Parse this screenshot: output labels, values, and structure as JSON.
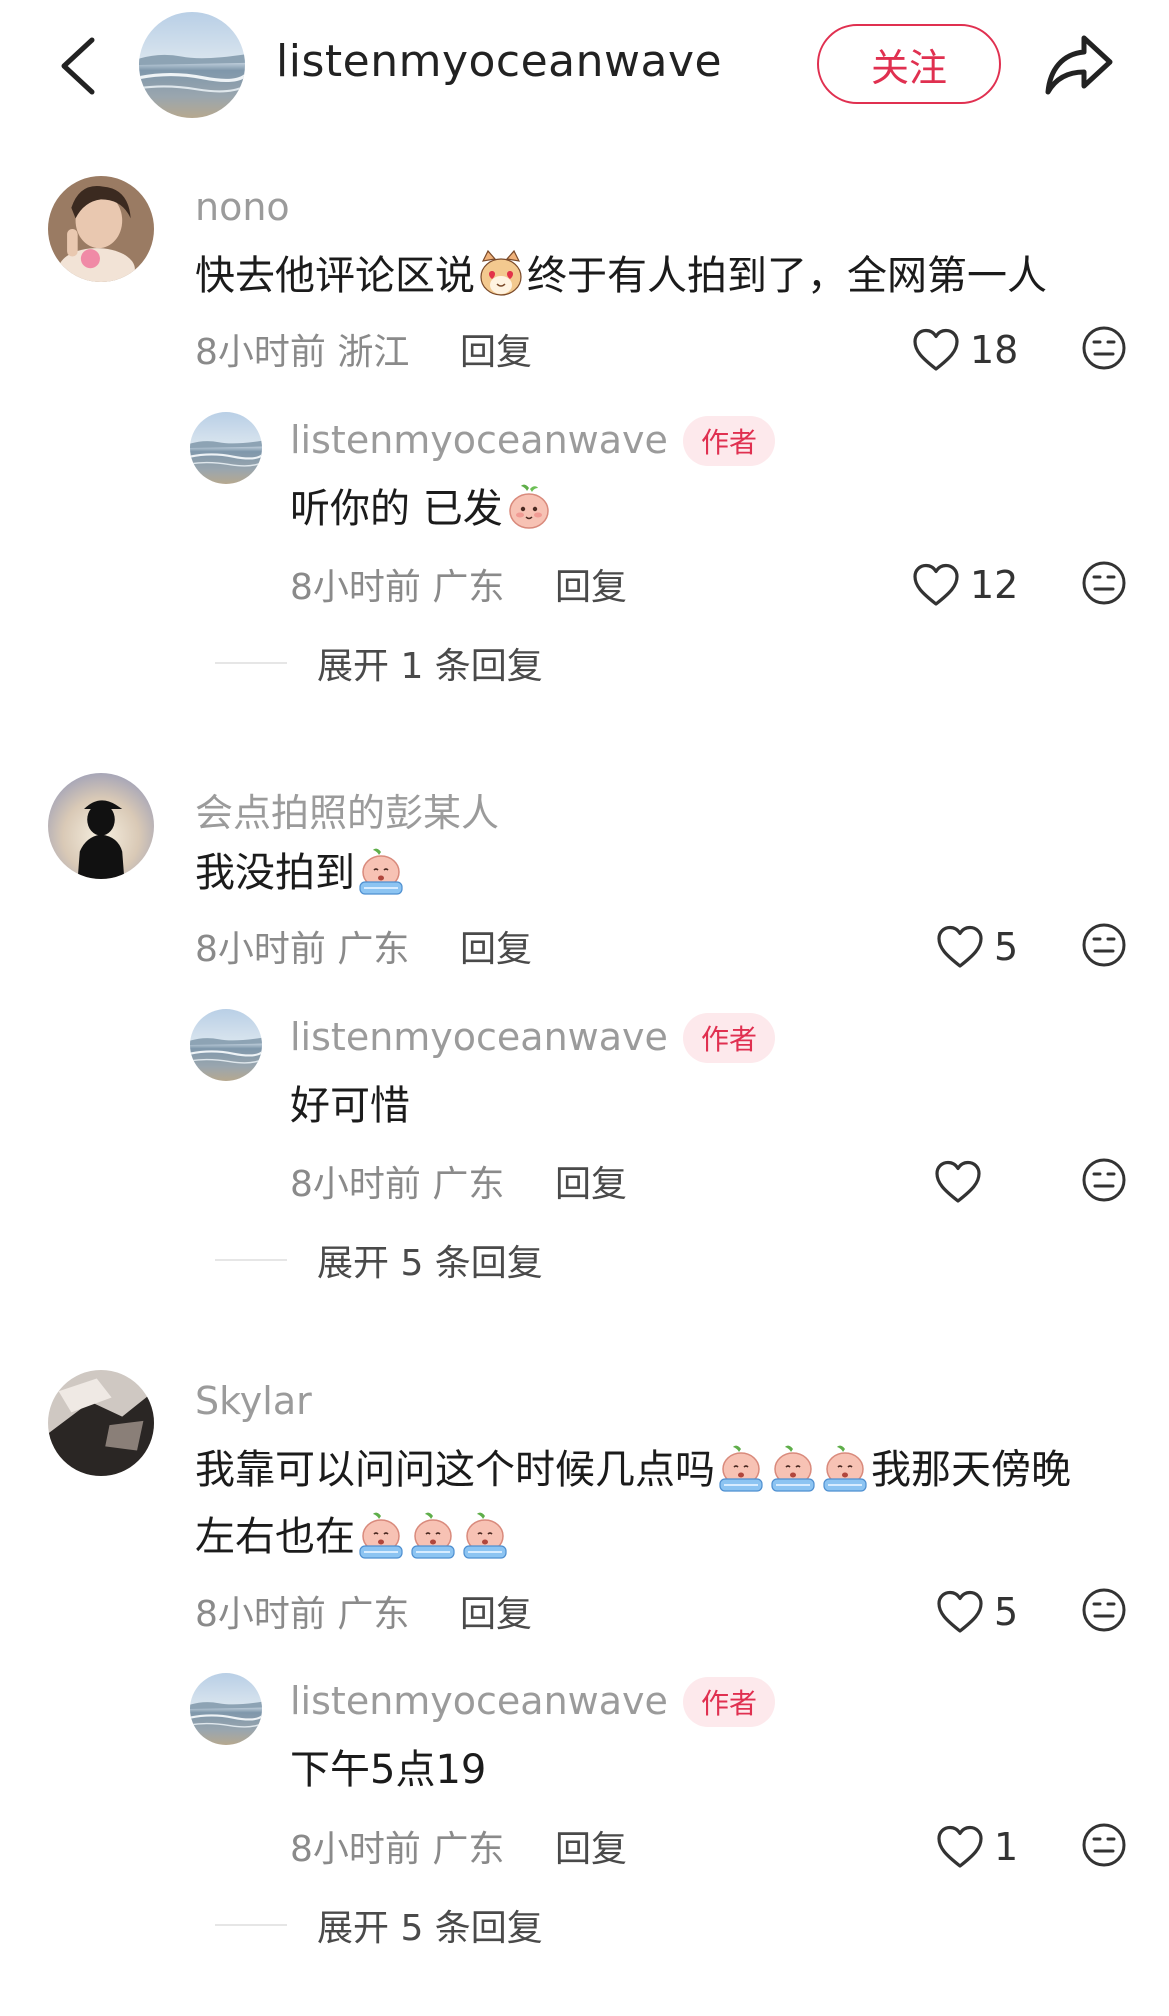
{
  "header": {
    "username": "listenmyoceanwave",
    "follow_label": "关注"
  },
  "colors": {
    "accent": "#e03050",
    "author_tag_bg": "#fde9ec",
    "meta": "#8a8a8a"
  },
  "comments": [
    {
      "username": "nono",
      "text_before": "快去他评论区说",
      "emoji": "heart-eyes-cat-emoji",
      "text_after": "终于有人拍到了，全网第一人",
      "time": "8小时前",
      "location": "浙江",
      "reply_label": "回复",
      "likes": "18",
      "reply": {
        "username": "listenmyoceanwave",
        "author_tag": "作者",
        "text": "听你的 已发",
        "emoji": "peach-shy-emoji",
        "time": "8小时前",
        "location": "广东",
        "reply_label": "回复",
        "likes": "12"
      },
      "expand_label": "展开 1 条回复"
    },
    {
      "username": "会点拍照的彭某人",
      "text": "我没拍到",
      "emoji": "peach-crying-emoji",
      "time": "8小时前",
      "location": "广东",
      "reply_label": "回复",
      "likes": "5",
      "reply": {
        "username": "listenmyoceanwave",
        "author_tag": "作者",
        "text": "好可惜",
        "time": "8小时前",
        "location": "广东",
        "reply_label": "回复",
        "likes": ""
      },
      "expand_label": "展开 5 条回复"
    },
    {
      "username": "Skylar",
      "line1_before": "我靠可以问问这个时候几点吗",
      "line1_after": "我那天傍晚",
      "line2": "左右也在",
      "emoji": "peach-tears-emoji",
      "time": "8小时前",
      "location": "广东",
      "reply_label": "回复",
      "likes": "5",
      "reply": {
        "username": "listenmyoceanwave",
        "author_tag": "作者",
        "text": "下午5点19",
        "time": "8小时前",
        "location": "广东",
        "reply_label": "回复",
        "likes": "1"
      },
      "expand_label": "展开 5 条回复"
    }
  ]
}
